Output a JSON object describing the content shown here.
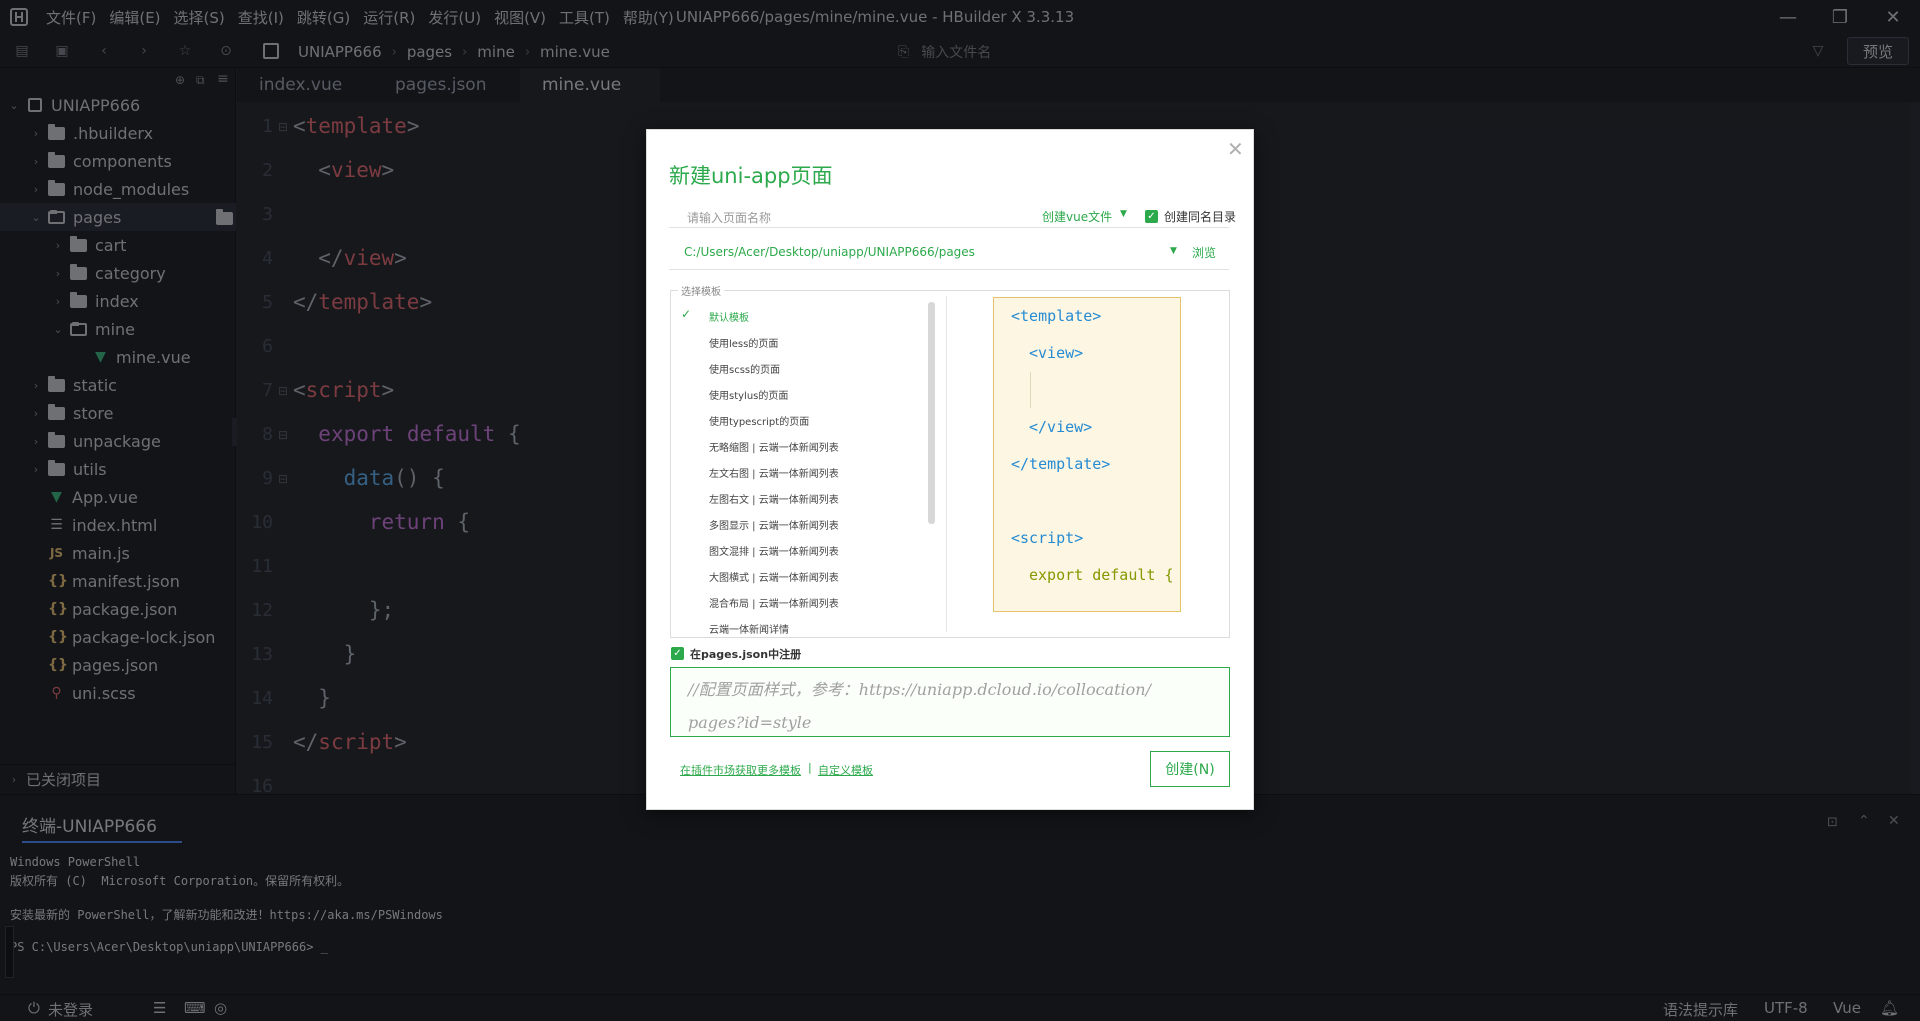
{
  "window": {
    "title": "UNIAPP666/pages/mine/mine.vue - HBuilder X 3.3.13",
    "min": "—",
    "restore": "❐",
    "close": "✕"
  },
  "menu": [
    "文件(F)",
    "编辑(E)",
    "选择(S)",
    "查找(I)",
    "跳转(G)",
    "运行(R)",
    "发行(U)",
    "视图(V)",
    "工具(T)",
    "帮助(Y)"
  ],
  "breadcrumb": [
    "UNIAPP666",
    "pages",
    "mine",
    "mine.vue"
  ],
  "toolbar": {
    "file_search_placeholder": "输入文件名",
    "preview_label": "预览"
  },
  "sidebar": {
    "project": "UNIAPP666",
    "items": [
      {
        "label": ".hbuilderx",
        "type": "folder"
      },
      {
        "label": "components",
        "type": "folder"
      },
      {
        "label": "node_modules",
        "type": "folder"
      },
      {
        "label": "pages",
        "type": "folder-open"
      },
      {
        "label": "cart",
        "type": "folder"
      },
      {
        "label": "category",
        "type": "folder"
      },
      {
        "label": "index",
        "type": "folder"
      },
      {
        "label": "mine",
        "type": "folder-open"
      },
      {
        "label": "mine.vue",
        "type": "vue"
      },
      {
        "label": "static",
        "type": "folder"
      },
      {
        "label": "store",
        "type": "folder"
      },
      {
        "label": "unpackage",
        "type": "folder"
      },
      {
        "label": "utils",
        "type": "folder"
      },
      {
        "label": "App.vue",
        "type": "vue"
      },
      {
        "label": "index.html",
        "type": "html"
      },
      {
        "label": "main.js",
        "type": "js"
      },
      {
        "label": "manifest.json",
        "type": "json"
      },
      {
        "label": "package.json",
        "type": "json"
      },
      {
        "label": "package-lock.json",
        "type": "json"
      },
      {
        "label": "pages.json",
        "type": "json"
      },
      {
        "label": "uni.scss",
        "type": "scss"
      }
    ],
    "closed_projects": "已关闭项目"
  },
  "tabs": [
    "index.vue",
    "pages.json",
    "mine.vue"
  ],
  "editor": {
    "line_numbers": [
      "1",
      "2",
      "3",
      "4",
      "5",
      "6",
      "7",
      "8",
      "9",
      "10",
      "11",
      "12",
      "13",
      "14",
      "15",
      "16"
    ]
  },
  "terminal": {
    "title": "终端-UNIAPP666",
    "lines": [
      "Windows PowerShell",
      "版权所有 (C)  Microsoft Corporation。保留所有权利。",
      "",
      "安装最新的 PowerShell，了解新功能和改进！https://aka.ms/PSWindows",
      "",
      "PS C:\\Users\\Acer\\Desktop\\uniapp\\UNIAPP666> _"
    ]
  },
  "statusbar": {
    "login": "未登录",
    "hint_lib": "语法提示库",
    "encoding": "UTF-8",
    "language": "Vue"
  },
  "dialog": {
    "title": "新建uni-app页面",
    "name_placeholder": "请输入页面名称",
    "create_type": "创建vue文件",
    "same_dir_label": "创建同名目录",
    "path": "C:/Users/Acer/Desktop/uniapp/UNIAPP666/pages",
    "browse": "浏览",
    "template_legend": "选择模板",
    "templates": [
      "默认模板",
      "使用less的页面",
      "使用scss的页面",
      "使用stylus的页面",
      "使用typescript的页面",
      "无略缩图 | 云端一体新闻列表",
      "左文右图 | 云端一体新闻列表",
      "左图右文 | 云端一体新闻列表",
      "多图显示 | 云端一体新闻列表",
      "图文混排 | 云端一体新闻列表",
      "大图横式 | 云端一体新闻列表",
      "混合布局 | 云端一体新闻列表",
      "云端一体新闻详情"
    ],
    "register_label": "在pages.json中注册",
    "style_comment_1": "//配置页面样式，参考：https://uniapp.dcloud.io/collocation/",
    "style_comment_2": "pages?id=style",
    "market_link": "在插件市场获取更多模板",
    "link_sep": "|",
    "custom_link": "自定义模板",
    "create_button": "创建(N)"
  },
  "colors": {
    "accent_green": "#2ca94b",
    "editor_bg": "#282c34",
    "sidebar_bg": "#21252b"
  }
}
